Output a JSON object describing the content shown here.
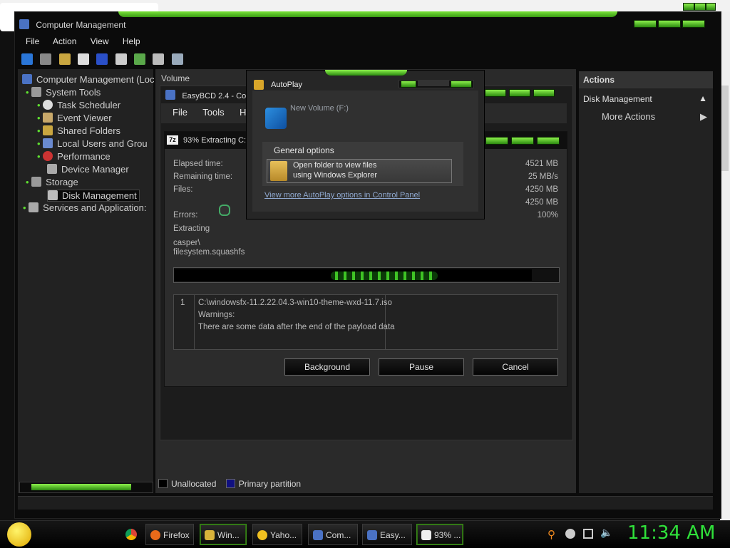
{
  "main_window": {
    "title": "Computer Management",
    "menu": [
      "File",
      "Action",
      "View",
      "Help"
    ]
  },
  "tree": {
    "root": "Computer Management (Loc",
    "items": [
      {
        "label": "System Tools",
        "icon": "tools-icon"
      },
      {
        "label": "Task Scheduler",
        "icon": "clock-icon"
      },
      {
        "label": "Event Viewer",
        "icon": "event-viewer-icon"
      },
      {
        "label": "Shared Folders",
        "icon": "shared-folders-icon"
      },
      {
        "label": "Local Users and Grou",
        "icon": "users-icon"
      },
      {
        "label": "Performance",
        "icon": "performance-icon"
      },
      {
        "label": "Device Manager",
        "icon": "device-manager-icon"
      },
      {
        "label": "Storage",
        "icon": "storage-icon"
      },
      {
        "label": "Disk Management",
        "icon": "disk-icon"
      },
      {
        "label": "Services and Application:",
        "icon": "services-icon"
      }
    ]
  },
  "center": {
    "volume_header": "Volume",
    "legend": [
      {
        "label": "Unallocated",
        "color": "#000000"
      },
      {
        "label": "Primary partition",
        "color": "#101080"
      }
    ]
  },
  "actions": {
    "header": "Actions",
    "section": "Disk Management",
    "more": "More Actions"
  },
  "easybcd": {
    "title": "EasyBCD 2.4 - Cou",
    "menu": [
      "File",
      "Tools",
      "He"
    ]
  },
  "sevenzip": {
    "title": "93% Extracting C:",
    "rows_left": [
      {
        "label": "Elapsed time:",
        "value": "4521 MB"
      },
      {
        "label": "Remaining time:",
        "value": "25 MB/s"
      },
      {
        "label": "Files:",
        "value": "4250 MB"
      },
      {
        "label": "",
        "value": "4250 MB"
      },
      {
        "label": "Errors:",
        "value": "100%"
      }
    ],
    "extracting_label": "Extracting",
    "current_file_1": "casper\\",
    "current_file_2": "filesystem.squashfs",
    "progress": 0.93,
    "messages": {
      "index": "1",
      "line1": "C:\\windowsfx-11.2.22.04.3-win10-theme-wxd-11.7.iso",
      "line2": "Warnings:",
      "line3": "There are some data after the end of the payload data"
    },
    "buttons": [
      "Background",
      "Pause",
      "Cancel"
    ]
  },
  "autoplay": {
    "title": "AutoPlay",
    "volume": "New Volume (F:)",
    "general_options": "General options",
    "option_line1": "Open folder to view files",
    "option_line2": "using Windows Explorer",
    "more_link": "View more AutoPlay options in Control Panel"
  },
  "taskbar": {
    "buttons": [
      {
        "label": "Firefox",
        "icon": "firefox-icon",
        "active": false
      },
      {
        "label": "Win...",
        "icon": "folder-icon",
        "active": true
      },
      {
        "label": "Yaho...",
        "icon": "yahoo-icon",
        "active": false
      },
      {
        "label": "Com...",
        "icon": "computer-management-icon",
        "active": false
      },
      {
        "label": "Easy...",
        "icon": "easybcd-icon",
        "active": false
      },
      {
        "label": "93% ...",
        "icon": "7zip-icon",
        "active": true
      }
    ],
    "clock": "11:34 AM"
  }
}
